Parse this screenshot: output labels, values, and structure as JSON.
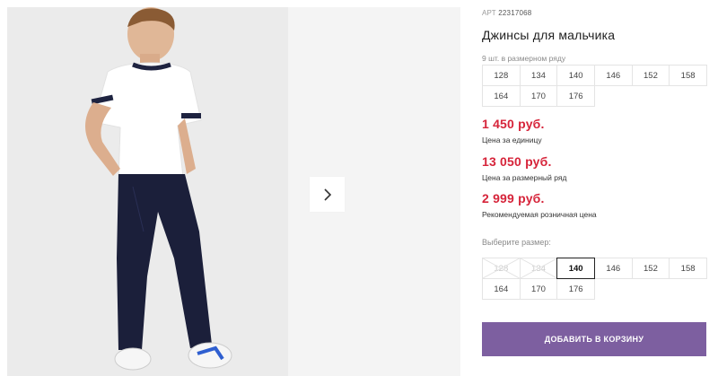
{
  "product": {
    "art_prefix": "АРТ",
    "art_number": "22317068",
    "title": "Джинсы для мальчика",
    "row_note": "9 шт. в размерном ряду",
    "row_sizes": [
      "128",
      "134",
      "140",
      "146",
      "152",
      "158",
      "164",
      "170",
      "176"
    ],
    "prices": [
      {
        "value": "1 450 руб.",
        "label": "Цена за единицу"
      },
      {
        "value": "13 050 руб.",
        "label": "Цена за размерный ряд"
      },
      {
        "value": "2 999 руб.",
        "label": "Рекомендуемая розничная цена"
      }
    ],
    "choose_label": "Выберите размер:",
    "select_sizes": [
      {
        "label": "128",
        "state": "disabled"
      },
      {
        "label": "134",
        "state": "disabled"
      },
      {
        "label": "140",
        "state": "selected"
      },
      {
        "label": "146",
        "state": "available"
      },
      {
        "label": "152",
        "state": "available"
      },
      {
        "label": "158",
        "state": "available"
      },
      {
        "label": "164",
        "state": "available"
      },
      {
        "label": "170",
        "state": "available"
      },
      {
        "label": "176",
        "state": "available"
      }
    ],
    "cart_button": "ДОБАВИТЬ В КОРЗИНУ"
  },
  "gallery": {
    "next_icon": "chevron-right-icon"
  },
  "colors": {
    "price": "#d6243a",
    "button": "#7d5fa0"
  }
}
